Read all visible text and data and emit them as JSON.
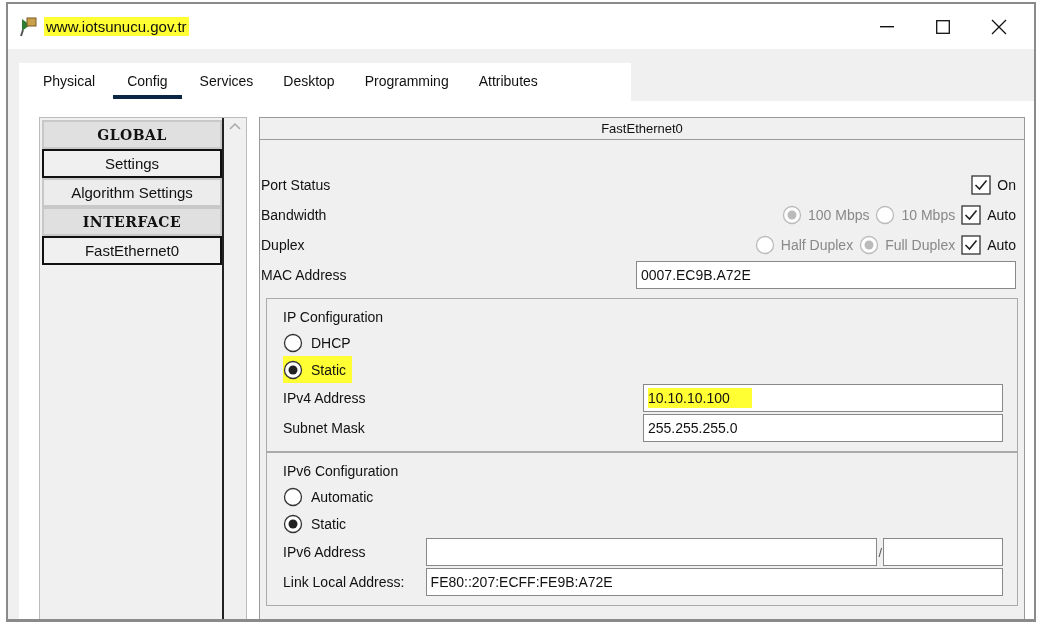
{
  "window": {
    "title": "www.iotsunucu.gov.tr",
    "title_highlighted": true
  },
  "tabs": [
    {
      "label": "Physical",
      "selected": false
    },
    {
      "label": "Config",
      "selected": true
    },
    {
      "label": "Services",
      "selected": false
    },
    {
      "label": "Desktop",
      "selected": false
    },
    {
      "label": "Programming",
      "selected": false
    },
    {
      "label": "Attributes",
      "selected": false
    }
  ],
  "sidebar": {
    "items": [
      {
        "label": "GLOBAL",
        "kind": "heading"
      },
      {
        "label": "Settings",
        "kind": "item"
      },
      {
        "label": "Algorithm Settings",
        "kind": "subitem"
      },
      {
        "label": "INTERFACE",
        "kind": "heading"
      },
      {
        "label": "FastEthernet0",
        "kind": "item"
      }
    ]
  },
  "panel": {
    "title": "FastEthernet0",
    "rows": [
      {
        "label": "Port Status",
        "kind": "check",
        "checkbox": {
          "label": "On",
          "checked": true
        }
      },
      {
        "label": "Bandwidth",
        "kind": "options",
        "disabled": true,
        "options": [
          {
            "label": "100 Mbps",
            "selected": true
          },
          {
            "label": "10 Mbps",
            "selected": false
          }
        ],
        "checkbox": {
          "label": "Auto",
          "checked": true
        }
      },
      {
        "label": "Duplex",
        "kind": "options",
        "disabled": true,
        "options": [
          {
            "label": "Half Duplex",
            "selected": false
          },
          {
            "label": "Full Duplex",
            "selected": true
          }
        ],
        "checkbox": {
          "label": "Auto",
          "checked": true
        }
      },
      {
        "label": "MAC Address",
        "kind": "field",
        "value": "0007.EC9B.A72E"
      }
    ],
    "ip_configuration": {
      "title": "IP Configuration",
      "options": [
        {
          "label": "DHCP",
          "selected": false,
          "highlighted": false
        },
        {
          "label": "Static",
          "selected": true,
          "highlighted": true
        }
      ],
      "fields": [
        {
          "label": "IPv4 Address",
          "value": "10.10.10.100",
          "highlighted": true
        },
        {
          "label": "Subnet Mask",
          "value": "255.255.255.0",
          "highlighted": false
        }
      ]
    },
    "ipv6_configuration": {
      "title": "IPv6 Configuration",
      "options": [
        {
          "label": "Automatic",
          "selected": false
        },
        {
          "label": "Static",
          "selected": true
        }
      ],
      "address": {
        "label": "IPv6 Address",
        "separator": "/"
      },
      "link_local": {
        "label": "Link Local Address:",
        "value": "FE80::207:ECFF:FE9B:A72E"
      }
    }
  }
}
